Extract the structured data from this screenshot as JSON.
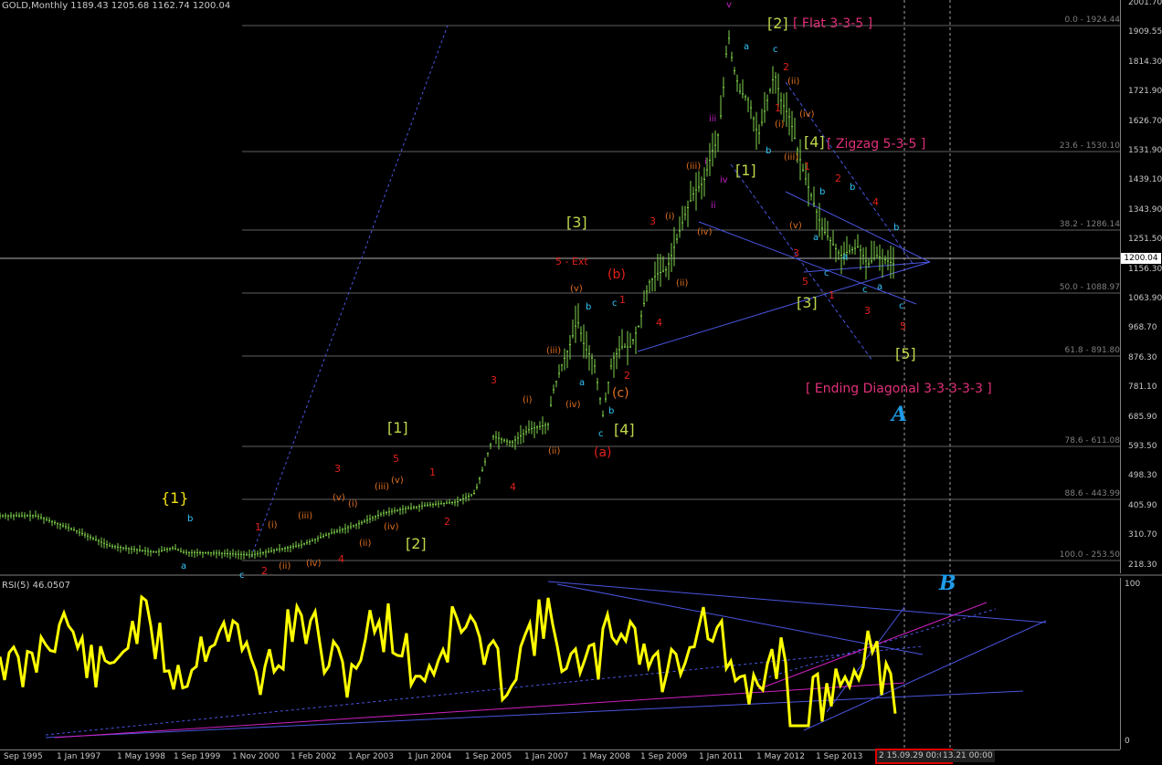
{
  "window": {
    "title": "GOLD,Monthly",
    "ohlc": "1189.43 1205.68 1162.74 1200.04",
    "current_price": "1200.04"
  },
  "rsi": {
    "title": "RSI(5) 46.0507",
    "axis_top": "100",
    "axis_bottom": "0"
  },
  "price_axis": [
    "2001.70",
    "1909.55",
    "1814.30",
    "1721.90",
    "1626.70",
    "1531.90",
    "1439.10",
    "1343.90",
    "1251.50",
    "1156.30",
    "1063.90",
    "968.70",
    "876.30",
    "781.10",
    "685.90",
    "593.50",
    "498.30",
    "405.90",
    "310.70",
    "218.30"
  ],
  "time_axis": [
    "Sep 1995",
    "1 Jan 1997",
    "1 May 1998",
    "1 Sep 1999",
    "1 Nov 2000",
    "1 Feb 2002",
    "1 Apr 2003",
    "1 Jun 2004",
    "1 Sep 2005",
    "1 Jan 2007",
    "1 May 2008",
    "1 Sep 2009",
    "1 Jan 2011",
    "1 May 2012",
    "1 Sep 2013",
    "2 15.09.29 00:00",
    "13.21 00:00"
  ],
  "fibo": [
    "0.0 - 1924.44",
    "23.6 - 1530.10",
    "38.2 - 1286.14",
    "50.0 - 1088.97",
    "61.8 - 891.80",
    "78.6 - 611.08",
    "88.6 - 443.99",
    "100.0 - 253.50"
  ],
  "annotations": {
    "flat": "[ Flat 3-3-5 ]",
    "zigzag": "[ Zigzag 5-3-5 ]",
    "ending_diag": "[ Ending Diagonal 3-3-3-3-3 ]",
    "five_ext": "5 - Ext",
    "big_a": "A",
    "big_b": "B"
  },
  "wave_labels": {
    "g_1_big": "[1]",
    "g_2_big": "[2]",
    "g_3_big": "[3]",
    "g_4_big": "[4]",
    "g_2_top": "[2]",
    "g_1_top": "[1]",
    "g_4_top": "[4]",
    "g_3_low": "[3]",
    "g_5_low": "[5]",
    "y_1": "{1}"
  },
  "colors": {
    "candle": "#7fd24b",
    "rsi": "#ffff00",
    "trend_blue": "#4a55e0",
    "trend_magenta": "#d020c0",
    "fibo": "#7f7f7f",
    "annot_magenta": "#e0307a",
    "wave_green": "#bdd74a"
  },
  "chart_data": {
    "type": "line",
    "symbol": "GOLD",
    "timeframe": "Monthly",
    "x": [
      "1995",
      "1997",
      "1998",
      "1999",
      "2000",
      "2001",
      "2002",
      "2003",
      "2004",
      "2005",
      "2006",
      "2007",
      "2008",
      "2009",
      "2010",
      "2011",
      "2012",
      "2013",
      "2014"
    ],
    "series": [
      {
        "values": [
          385,
          360,
          300,
          285,
          275,
          265,
          305,
          360,
          420,
          450,
          580,
          680,
          900,
          950,
          1250,
          1900,
          1700,
          1250,
          1200
        ]
      }
    ],
    "ylim": [
      218.3,
      2001.7
    ]
  }
}
